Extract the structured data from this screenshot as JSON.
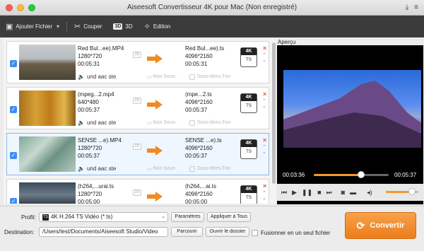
{
  "window": {
    "title": "Aiseesoft Convertisseur 4K pour Mac (Non enregistré)",
    "right_icons": [
      "download-icon",
      "menu-icon"
    ]
  },
  "toolbar": {
    "add_file": "Ajouter Fichier",
    "cut": "Couper",
    "three_d": "3D",
    "three_d_badge": "3D",
    "edit": "Edition"
  },
  "files": [
    {
      "src_name": "Red Bul...ee).MP4",
      "src_res": "1280*720",
      "src_dur": "00:05:31",
      "dst_name": "Red Bul...ee).ts",
      "dst_res": "4096*2160",
      "dst_dur": "00:05:31",
      "audio": "und aac ste",
      "subtitle": "Non Sous-",
      "subtitle_font": "Sous-titres Fon",
      "selected": false
    },
    {
      "src_name": "(mpeg...2.mp4",
      "src_res": "640*480",
      "src_dur": "00:05:37",
      "dst_name": "(mpe...2.ts",
      "dst_res": "4096*2160",
      "dst_dur": "00:05:37",
      "audio": "und aac ste",
      "subtitle": "Non Sous-",
      "subtitle_font": "Sous-titres Fon",
      "selected": false
    },
    {
      "src_name": "SENSE ...e).MP4",
      "src_res": "1280*720",
      "src_dur": "00:05:37",
      "dst_name": "SENSE ...e).ts",
      "dst_res": "4096*2160",
      "dst_dur": "00:05:37",
      "audio": "und aac ste",
      "subtitle": "Non Sous-",
      "subtitle_font": "Sous-titres Fon",
      "selected": true
    },
    {
      "src_name": "(h264,...urai.ts",
      "src_res": "1280*720",
      "src_dur": "00:05:00",
      "dst_name": "(h264,...ai.ts",
      "dst_res": "4096*2160",
      "dst_dur": "00:05:00",
      "audio": "",
      "subtitle": "",
      "subtitle_font": "",
      "selected": false
    }
  ],
  "format_badge": {
    "top": "4K",
    "bottom": "TS"
  },
  "preview": {
    "label": "Aperçu",
    "time_current": "00:03:36",
    "time_total": "00:05:37",
    "progress": 0.63,
    "volume": 0.8
  },
  "bottom": {
    "profile_label": "Profil:",
    "profile_value": "4K H.264 TS Vidéo (*.ts)",
    "profile_badge": "TS",
    "settings_button": "Paramètres",
    "apply_all_button": "Appliquer à Tous",
    "destination_label": "Destination:",
    "destination_value": "/Users/test/Documents/Aiseesoft Studio/Video",
    "browse_button": "Parcourir",
    "open_folder_button": "Ouvrir le dossier",
    "merge_label": "Fusionner en un seul fichier",
    "convert_button": "Convertir"
  },
  "colors": {
    "accent": "#ec7d1c",
    "toolbar": "#3b3b3b",
    "checkbox": "#3d8ef5",
    "remove": "#e8572a"
  }
}
